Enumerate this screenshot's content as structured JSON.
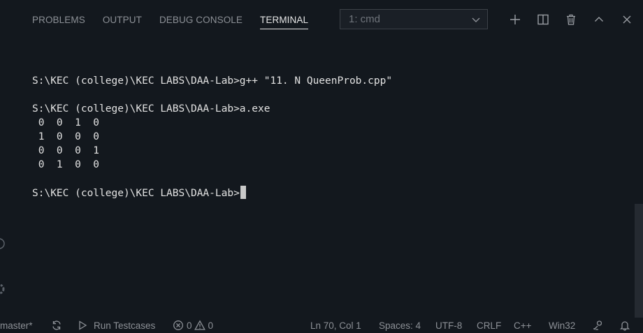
{
  "panel": {
    "tabs": [
      {
        "label": "PROBLEMS",
        "active": false
      },
      {
        "label": "OUTPUT",
        "active": false
      },
      {
        "label": "DEBUG CONSOLE",
        "active": false
      },
      {
        "label": "TERMINAL",
        "active": true
      }
    ],
    "terminal_select": "1: cmd",
    "actions": [
      "plus-icon",
      "split-icon",
      "trash-icon",
      "chevron-up-icon",
      "close-icon"
    ]
  },
  "terminal": {
    "lines": [
      "",
      "S:\\KEC (college)\\KEC LABS\\DAA-Lab>g++ \"11. N QueenProb.cpp\"",
      "",
      "S:\\KEC (college)\\KEC LABS\\DAA-Lab>a.exe",
      " 0  0  1  0",
      " 1  0  0  0",
      " 0  0  0  1",
      " 0  1  0  0",
      ""
    ],
    "prompt": "S:\\KEC (college)\\KEC LABS\\DAA-Lab>"
  },
  "statusbar": {
    "branch": "master*",
    "run_testcases": "Run Testcases",
    "errors": "0",
    "warnings": "0",
    "position": "Ln 70, Col 1",
    "spaces": "Spaces: 4",
    "encoding": "UTF-8",
    "eol": "CRLF",
    "language": "C++",
    "platform": "Win32"
  },
  "colors": {
    "background": "#13181e",
    "text": "#e2e2e2",
    "muted": "#8c9096",
    "border": "#3c4148"
  }
}
